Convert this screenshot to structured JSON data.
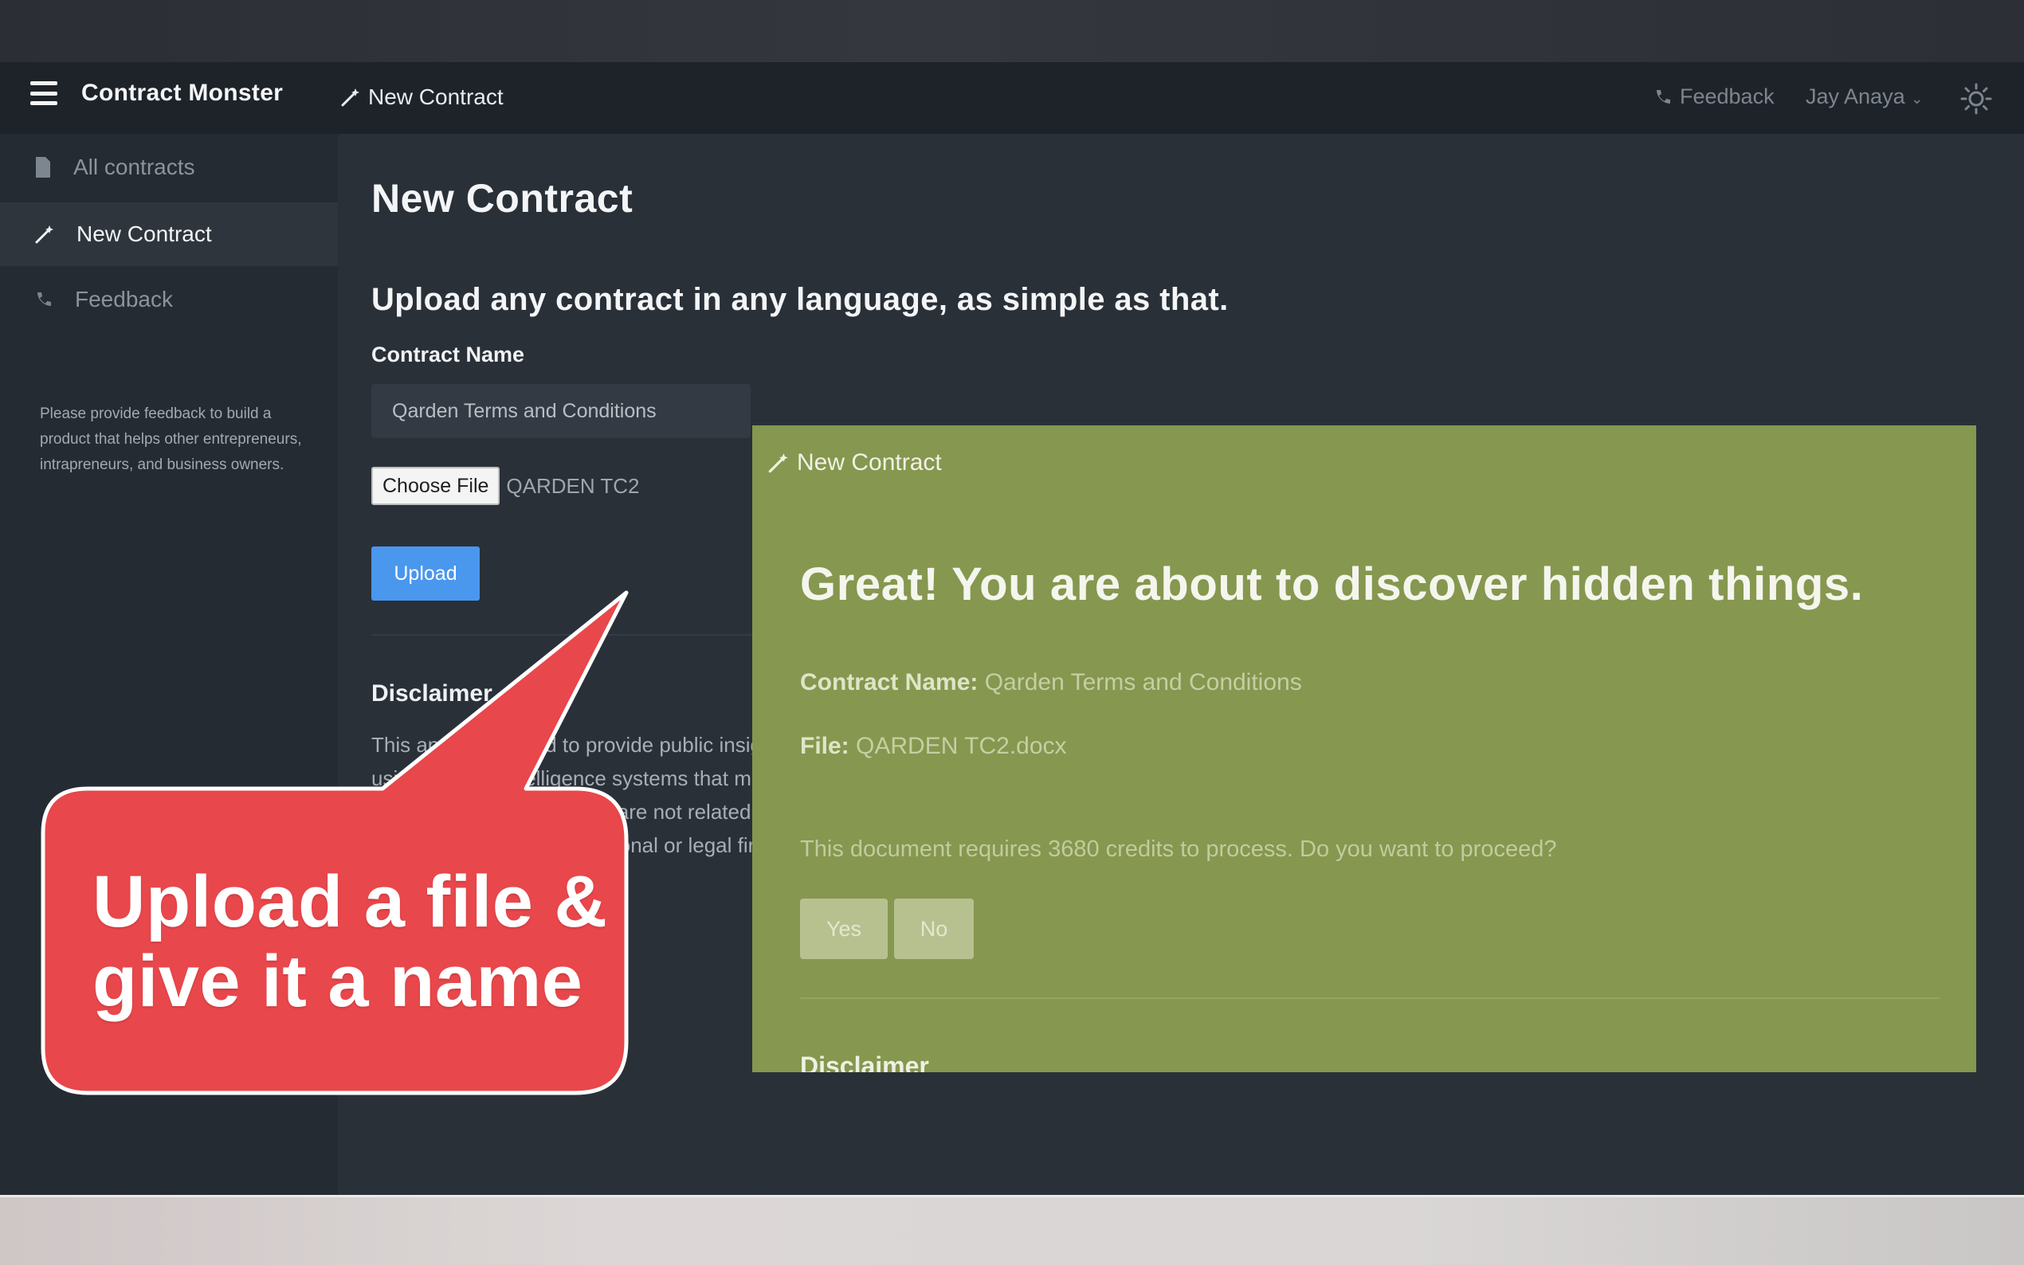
{
  "navbar": {
    "brand": "Contract Monster",
    "current_page": "New Contract",
    "feedback": "Feedback",
    "user": "Jay Anaya"
  },
  "sidebar": {
    "items": [
      {
        "label": "All contracts",
        "icon": "document-icon"
      },
      {
        "label": "New Contract",
        "icon": "magic-wand-icon",
        "active": true
      },
      {
        "label": "Feedback",
        "icon": "phone-icon"
      }
    ],
    "note": "Please provide feedback to build a product that helps other entrepreneurs, intrapreneurs, and business owners."
  },
  "main": {
    "title": "New Contract",
    "subtitle": "Upload any contract in any language, as simple as that.",
    "field_label": "Contract Name",
    "contract_name_value": "Qarden Terms and Conditions",
    "choose_file_label": "Choose File",
    "selected_file": "QARDEN TC2",
    "upload_label": "Upload",
    "disclaimer_title": "Disclaimer",
    "disclaimer_text": "This app is intended to provide public insights using artificial intelligence systems that may contain errors. The results are not related to individual qualified professional or legal firms assessment."
  },
  "modal": {
    "header": "New Contract",
    "title": "Great! You are about to discover hidden things.",
    "contract_name_label": "Contract Name:",
    "contract_name_value": "Qarden Terms and Conditions",
    "file_label": "File:",
    "file_value": "QARDEN TC2.docx",
    "question": "This document requires 3680 credits to process. Do you want to proceed?",
    "yes_label": "Yes",
    "no_label": "No",
    "cut_title": "Disclaimer"
  },
  "callout": {
    "line1": "Upload a file &",
    "line2": "give it a name"
  },
  "colors": {
    "navbar": "#1e232a",
    "sidebar": "#252b33",
    "main": "#2a3038",
    "upload_button": "#4a97ee",
    "modal": "#86974f",
    "callout": "#e8474b"
  }
}
